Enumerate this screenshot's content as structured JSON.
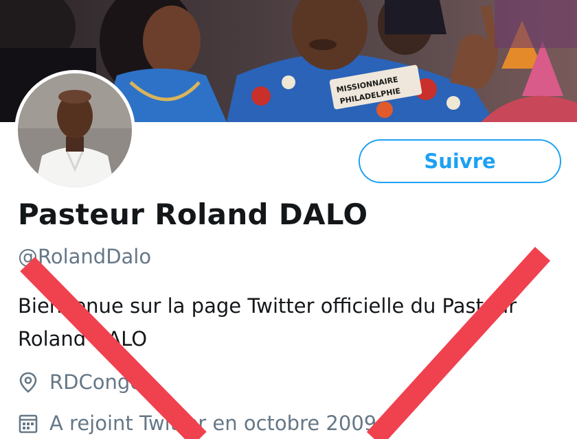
{
  "profile": {
    "display_name": "Pasteur Roland DALO",
    "handle": "@RolandDalo",
    "bio": "Bienvenue sur la page Twitter officielle du Pasteur Roland DALO",
    "location": "RDCongo",
    "joined": "A rejoint Twitter en octobre 2009"
  },
  "actions": {
    "follow_label": "Suivre"
  },
  "banner": {
    "shirt_text_line1": "MISSIONNAIRE",
    "shirt_text_line2": "PHILADELPHIE"
  },
  "icons": {
    "location": "location-pin-icon",
    "joined": "calendar-icon"
  },
  "colors": {
    "accent": "#1da1f2",
    "secondary_text": "#657786",
    "primary_text": "#14171a",
    "cross_overlay": "#f0414f"
  }
}
